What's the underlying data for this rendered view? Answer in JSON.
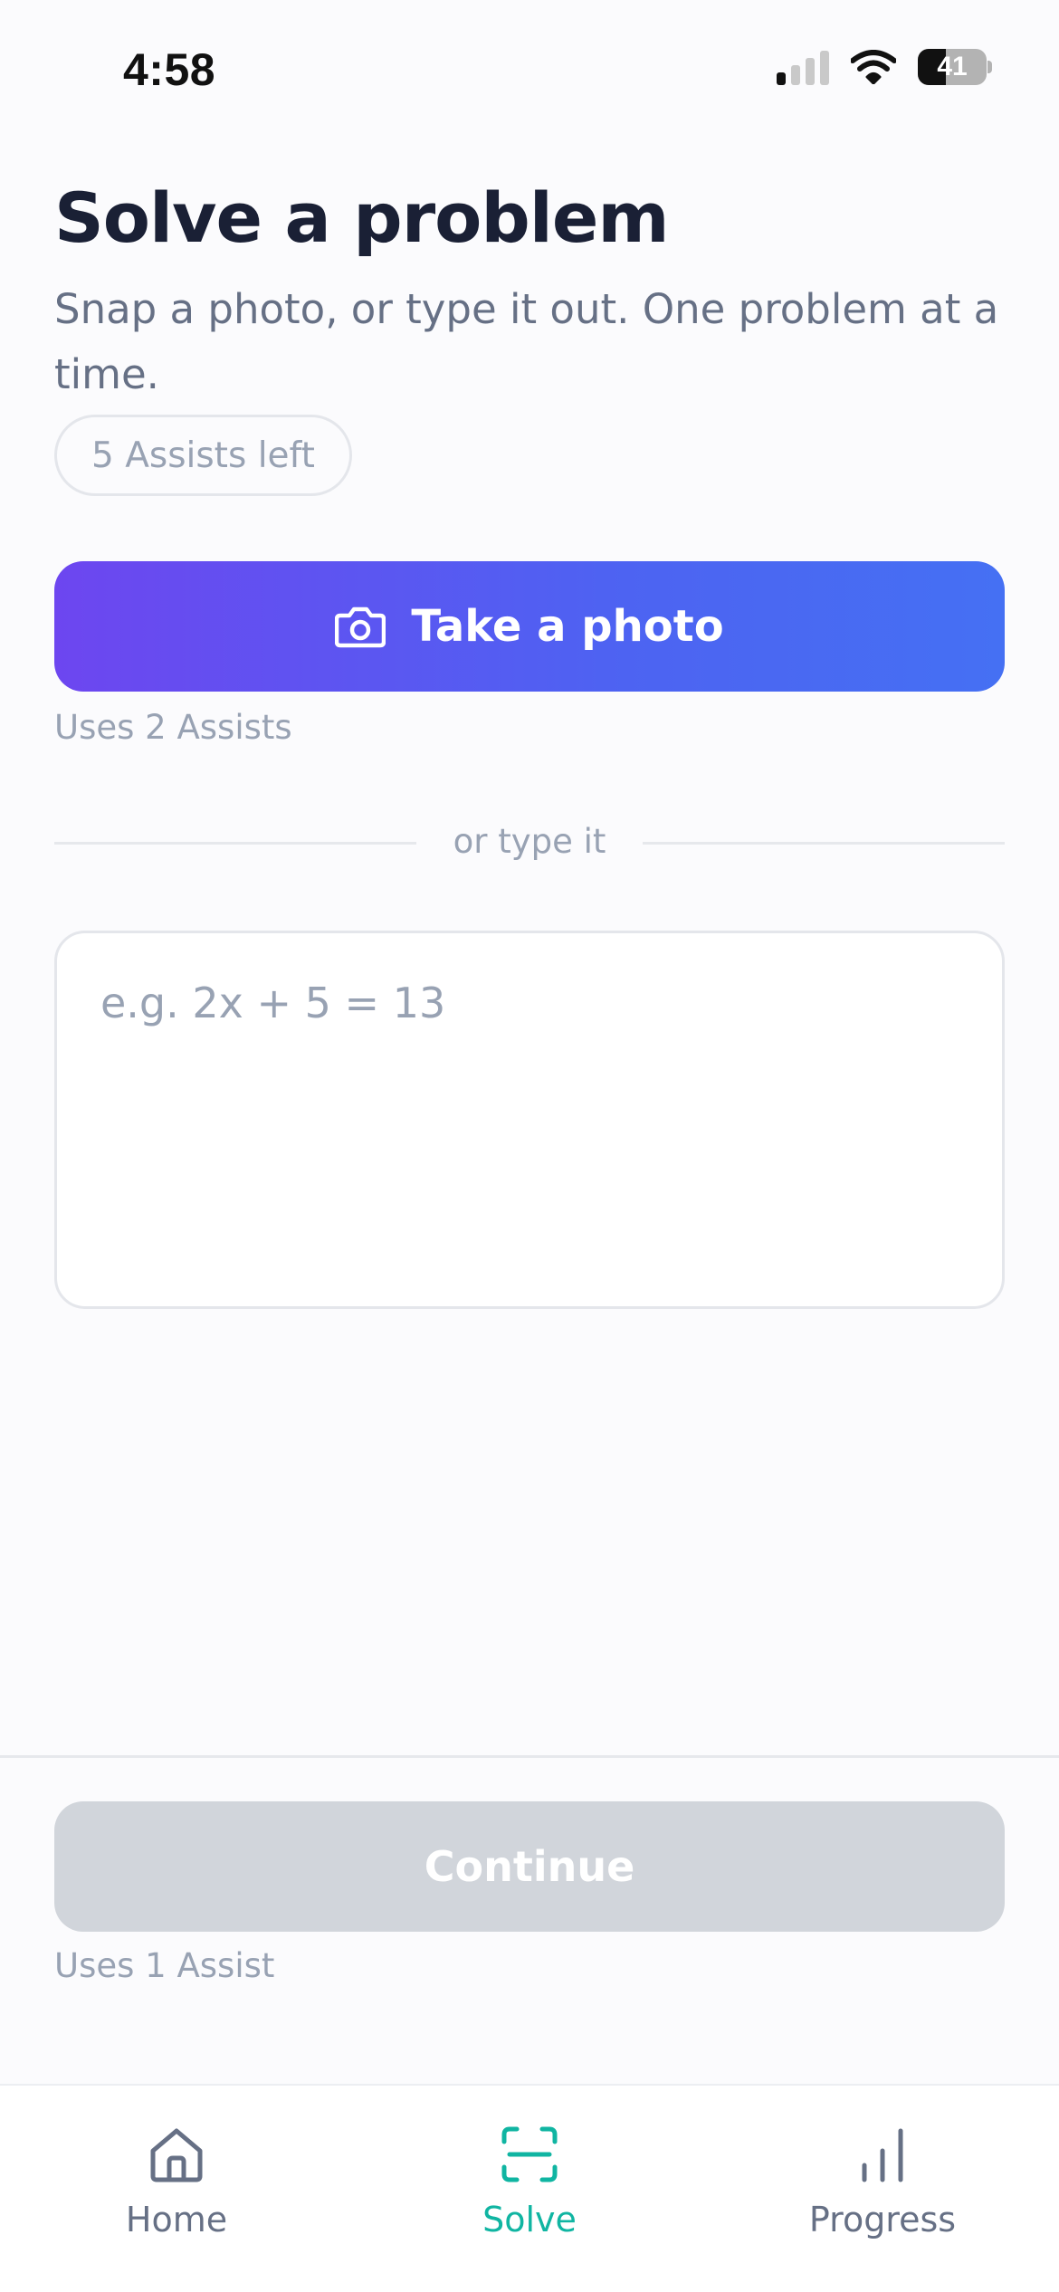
{
  "status_bar": {
    "time": "4:58",
    "battery_level": "41",
    "battery_fraction": 0.41,
    "signal_bars_active": 1,
    "signal_bars_total": 4
  },
  "header": {
    "title": "Solve a problem",
    "subtitle": "Snap a photo, or type it out. One problem at a time.",
    "assists_left": "5 Assists left"
  },
  "photo": {
    "button_label": "Take a photo",
    "button_icon": "camera-icon",
    "cost_hint": "Uses 2 Assists"
  },
  "divider": {
    "label": "or type it"
  },
  "problem_input": {
    "placeholder": "e.g. 2x + 5 = 13",
    "value": ""
  },
  "footer": {
    "continue_label": "Continue",
    "cost_hint": "Uses 1 Assist"
  },
  "tabbar": {
    "tabs": [
      {
        "label": "Home",
        "icon": "home-icon",
        "active": false
      },
      {
        "label": "Solve",
        "icon": "scan-icon",
        "active": true
      },
      {
        "label": "Progress",
        "icon": "bar-chart-icon",
        "active": false
      }
    ]
  },
  "colors": {
    "accent_gradient_start": "#6d46f0",
    "accent_gradient_end": "#4570f3",
    "active_tab": "#10b5a2",
    "disabled_button": "#d1d5db",
    "title": "#1a2035",
    "muted_text": "#98a2b3"
  }
}
